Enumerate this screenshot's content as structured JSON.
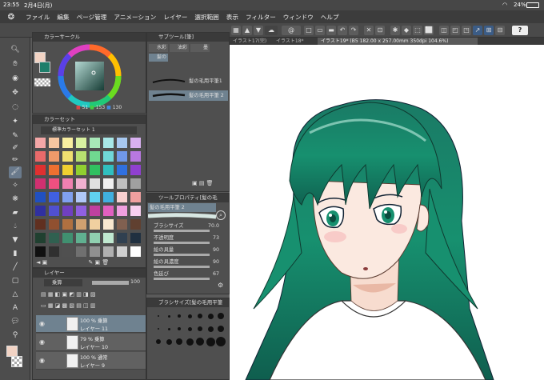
{
  "status_bar": {
    "time": "23:55",
    "date": "2月4日(月)",
    "battery": "24%"
  },
  "menu": [
    "ファイル",
    "編集",
    "ページ管理",
    "アニメーション",
    "レイヤー",
    "選択範囲",
    "表示",
    "フィルター",
    "ウィンドウ",
    "ヘルプ"
  ],
  "doc_tabs": [
    "イラスト17(完)",
    "イラスト18*",
    "イラスト19* (B5 182.00 x 257.00mm 350dpi 104.6%)"
  ],
  "color_circle": {
    "title": "カラーサークル",
    "r": "51",
    "g": "153",
    "b": "130",
    "main_color": "#f2d3c4",
    "sub_color": "#1e7e6a"
  },
  "color_set": {
    "title": "カラーセット",
    "set_name": "標準カラーセット 1"
  },
  "sub_tool": {
    "title": "サブツール[筆]",
    "tabs": [
      "水彩",
      "油彩",
      "墨",
      "髪の"
    ],
    "brushes": [
      "髪の毛用平筆1",
      "髪の毛用平筆 2"
    ]
  },
  "tool_property": {
    "title": "ツールプロパティ[髪の毛",
    "brush_name": "髪の毛用平筆 2",
    "props": [
      {
        "label": "ブラシサイズ",
        "value": "70.0"
      },
      {
        "label": "不透明度",
        "value": "73"
      },
      {
        "label": "絵の具量",
        "value": "90"
      },
      {
        "label": "絵の具濃度",
        "value": "90"
      },
      {
        "label": "色延び",
        "value": "67"
      }
    ]
  },
  "brush_size": {
    "title": "ブラシサイズ[髪の毛用平筆"
  },
  "layer_panel": {
    "title": "レイヤー",
    "blend_mode": "乗算",
    "opacity": "100",
    "layers": [
      {
        "line1": "100 % 乗算",
        "line2": "レイヤー 11"
      },
      {
        "line1": "79 % 乗算",
        "line2": "レイヤー 10"
      },
      {
        "line1": "100 % 通常",
        "line2": "レイヤー 9"
      }
    ]
  }
}
